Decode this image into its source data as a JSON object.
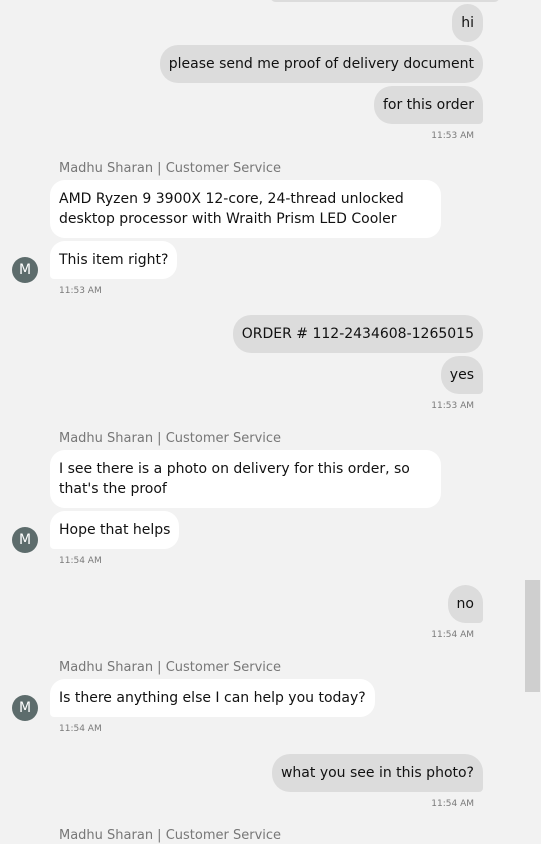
{
  "messages": {
    "m1": "hi",
    "m2": "please send me proof of delivery document",
    "m3": "for this order",
    "t1": "11:53 AM",
    "sender1": "Madhu Sharan | Customer Service",
    "a1": "AMD Ryzen 9 3900X 12-core, 24-thread unlocked desktop processor with Wraith Prism LED Cooler",
    "a2": "This item right?",
    "t2": "11:53 AM",
    "avatar_letter": "M",
    "m4": "ORDER # 112-2434608-1265015",
    "m5": "yes",
    "t3": "11:53 AM",
    "sender2": "Madhu Sharan | Customer Service",
    "a3": "I see there is a photo on delivery for this order, so that's the proof",
    "a4": "Hope that helps",
    "t4": "11:54 AM",
    "m6": "no",
    "t5": "11:54 AM",
    "sender3": "Madhu Sharan | Customer Service",
    "a5": "Is there anything else I can help you today?",
    "t6": "11:54 AM",
    "m7": "what you see in this photo?",
    "t7": "11:54 AM",
    "sender4": "Madhu Sharan | Customer Service"
  },
  "colors": {
    "background": "#f2f2f2",
    "user_bubble": "#dcdcdc",
    "agent_bubble": "#ffffff",
    "avatar": "#5d6c6c"
  }
}
